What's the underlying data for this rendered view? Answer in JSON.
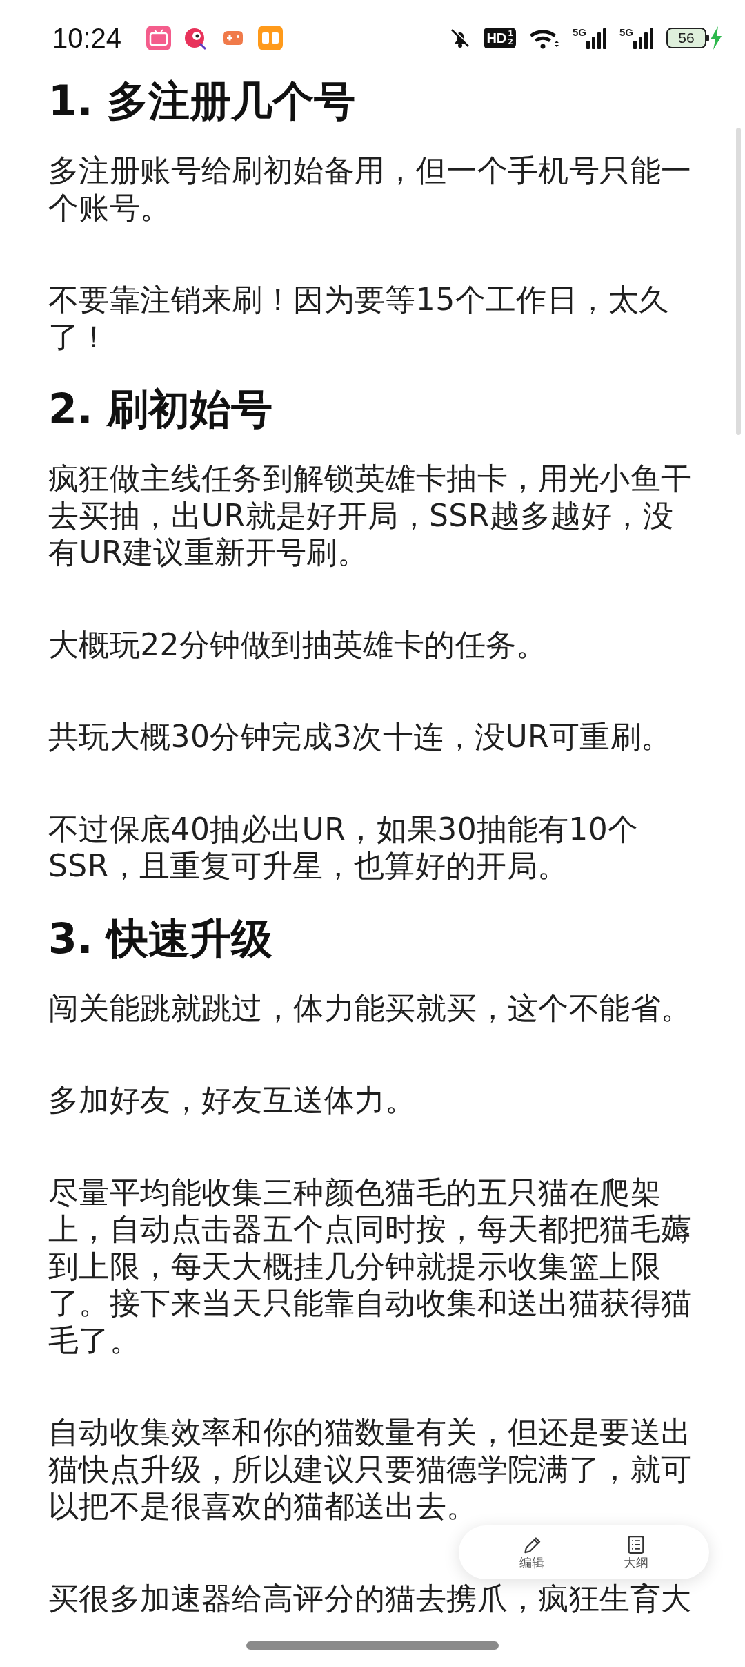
{
  "status_bar": {
    "time": "10:24",
    "app_icons": [
      {
        "kind": "tv"
      },
      {
        "kind": "bird"
      },
      {
        "kind": "gamepad"
      },
      {
        "kind": "orange"
      }
    ],
    "silent": true,
    "hd": {
      "label": "HD",
      "sims": [
        "1",
        "2"
      ]
    },
    "signals": [
      {
        "label": "5G"
      },
      {
        "label": "5G"
      }
    ],
    "battery": {
      "label": "56",
      "charging": true
    }
  },
  "article": {
    "blocks": [
      {
        "kind": "heading",
        "text": "1. 多注册几个号"
      },
      {
        "kind": "paragraph",
        "text": "多注册账号给刷初始备用，但一个手机号只能一个账号。"
      },
      {
        "kind": "paragraph",
        "text": "不要靠注销来刷！因为要等15个工作日，太久了！"
      },
      {
        "kind": "heading",
        "text": "2. 刷初始号"
      },
      {
        "kind": "paragraph",
        "text": "疯狂做主线任务到解锁英雄卡抽卡，用光小鱼干去买抽，出UR就是好开局，SSR越多越好，没有UR建议重新开号刷。"
      },
      {
        "kind": "paragraph",
        "text": "大概玩22分钟做到抽英雄卡的任务。"
      },
      {
        "kind": "paragraph",
        "text": "共玩大概30分钟完成3次十连，没UR可重刷。"
      },
      {
        "kind": "paragraph",
        "text": "不过保底40抽必出UR，如果30抽能有10个SSR，且重复可升星，也算好的开局。"
      },
      {
        "kind": "heading",
        "text": "3. 快速升级"
      },
      {
        "kind": "paragraph",
        "text": "闯关能跳就跳过，体力能买就买，这个不能省。"
      },
      {
        "kind": "paragraph",
        "text": "多加好友，好友互送体力。"
      },
      {
        "kind": "paragraph",
        "text": "尽量平均能收集三种颜色猫毛的五只猫在爬架上，自动点击器五个点同时按，每天都把猫毛薅到上限，每天大概挂几分钟就提示收集篮上限了。接下来当天只能靠自动收集和送出猫获得猫毛了。"
      },
      {
        "kind": "paragraph",
        "text": "自动收集效率和你的猫数量有关，但还是要送出猫快点升级，所以建议只要猫德学院满了，就可以把不是很喜欢的猫都送出去。"
      },
      {
        "kind": "paragraph",
        "text": "买很多加速器给高评分的猫去携爪，疯狂生育大"
      }
    ]
  },
  "floating_bar": {
    "buttons": [
      {
        "kind": "edit",
        "label": "编辑"
      },
      {
        "kind": "outline",
        "label": "大纲"
      }
    ]
  }
}
